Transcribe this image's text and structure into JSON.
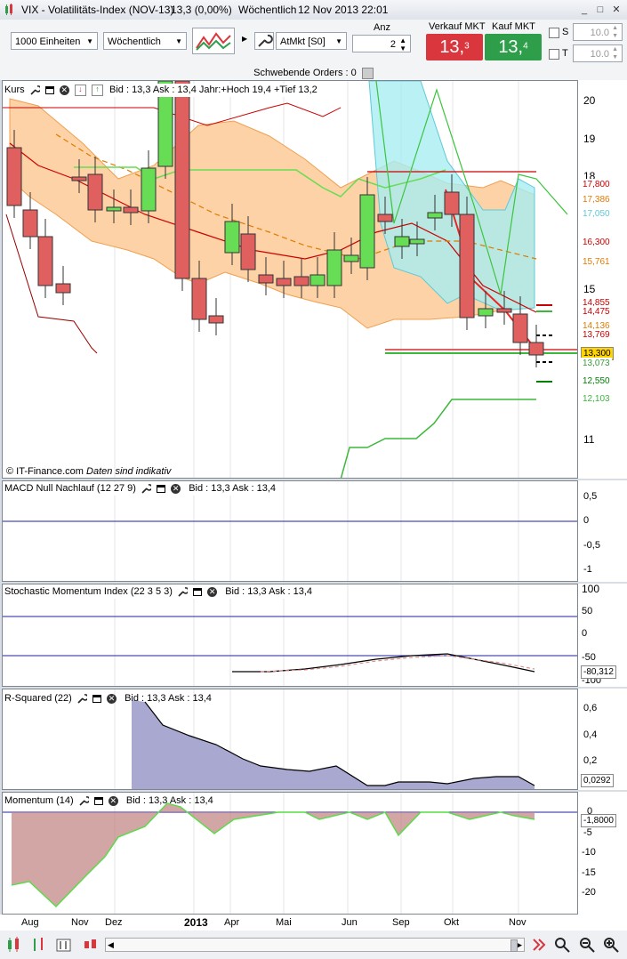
{
  "window": {
    "title": "VIX - Volatilitäts-Index (NOV-13)",
    "quote": "13,3 (0,00%)",
    "period": "Wöchentlich",
    "datetime": "12 Nov 2013 22:01"
  },
  "toolbar": {
    "units": "1000 Einheiten",
    "interval": "Wöchentlich",
    "order_type": "AtMkt [S0]",
    "qty_label": "Anz",
    "qty_value": "2",
    "sell_label": "Verkauf MKT",
    "sell_price": "13,",
    "sell_sup": "3",
    "buy_label": "Kauf MKT",
    "buy_price": "13,",
    "buy_sup": "4",
    "s_label": "S",
    "t_label": "T",
    "s_value": "10.0",
    "t_value": "10.0",
    "pending_orders": "Schwebende Orders : 0"
  },
  "panels": {
    "price": {
      "label": "Kurs",
      "info": "Bid : 13,3 Ask : 13,4 Jahr:+Hoch 19,4 +Tief 13,2",
      "watermark": "© IT-Finance.com",
      "watermark2": "Daten sind indikativ",
      "axis": [
        "20",
        "19",
        "18",
        "15",
        "11"
      ],
      "price_labels": [
        {
          "v": "17,800",
          "bg": "#ffffff",
          "fg": "#cc0000"
        },
        {
          "v": "17,386",
          "bg": "#ffffff",
          "fg": "#e07b00"
        },
        {
          "v": "17,050",
          "bg": "#ffffff",
          "fg": "#5ec9d6"
        },
        {
          "v": "16,300",
          "bg": "#ffffff",
          "fg": "#cc0000"
        },
        {
          "v": "15,761",
          "bg": "#ffffff",
          "fg": "#e07b00"
        },
        {
          "v": "14,855",
          "bg": "#ffffff",
          "fg": "#cc0000"
        },
        {
          "v": "14,475",
          "bg": "#ffffff",
          "fg": "#cc0000"
        },
        {
          "v": "14,136",
          "bg": "#ffffff",
          "fg": "#e07b00"
        },
        {
          "v": "13,769",
          "bg": "#ffffff",
          "fg": "#cc0000"
        },
        {
          "v": "13,300",
          "bg": "#ffd400",
          "fg": "#000000"
        },
        {
          "v": "13,073",
          "bg": "#ffffff",
          "fg": "#3a9a3a"
        },
        {
          "v": "12,550",
          "bg": "#ffffff",
          "fg": "#008000"
        },
        {
          "v": "12,103",
          "bg": "#ffffff",
          "fg": "#3cb83c"
        }
      ]
    },
    "macd": {
      "label": "MACD Null Nachlauf (12 27 9)",
      "info": "Bid : 13,3 Ask : 13,4",
      "axis": [
        "0,5",
        "0",
        "-0,5",
        "-1"
      ]
    },
    "stoch": {
      "label": "Stochastic Momentum Index (22 3 5 3)",
      "info": "Bid : 13,3 Ask : 13,4",
      "axis": [
        "100",
        "50",
        "0",
        "-50",
        "-100"
      ],
      "last": "-80,312"
    },
    "rsq": {
      "label": "R-Squared (22)",
      "info": "Bid : 13,3 Ask : 13,4",
      "axis": [
        "0,6",
        "0,4",
        "0,2"
      ],
      "last": "0,0292"
    },
    "mom": {
      "label": "Momentum (14)",
      "info": "Bid : 13,3 Ask : 13,4",
      "axis": [
        "0",
        "-5",
        "-10",
        "-15",
        "-20"
      ],
      "last": "-1,8000"
    }
  },
  "xaxis": [
    "Aug",
    "Nov",
    "Dez",
    "2013",
    "Apr",
    "Mai",
    "Jun",
    "Sep",
    "Okt",
    "Nov"
  ],
  "colors": {
    "up": "#66dd55",
    "down": "#e06060",
    "band": "#fcd2a6",
    "accent_sell": "#d9363e",
    "accent_buy": "#2f9e4a"
  }
}
